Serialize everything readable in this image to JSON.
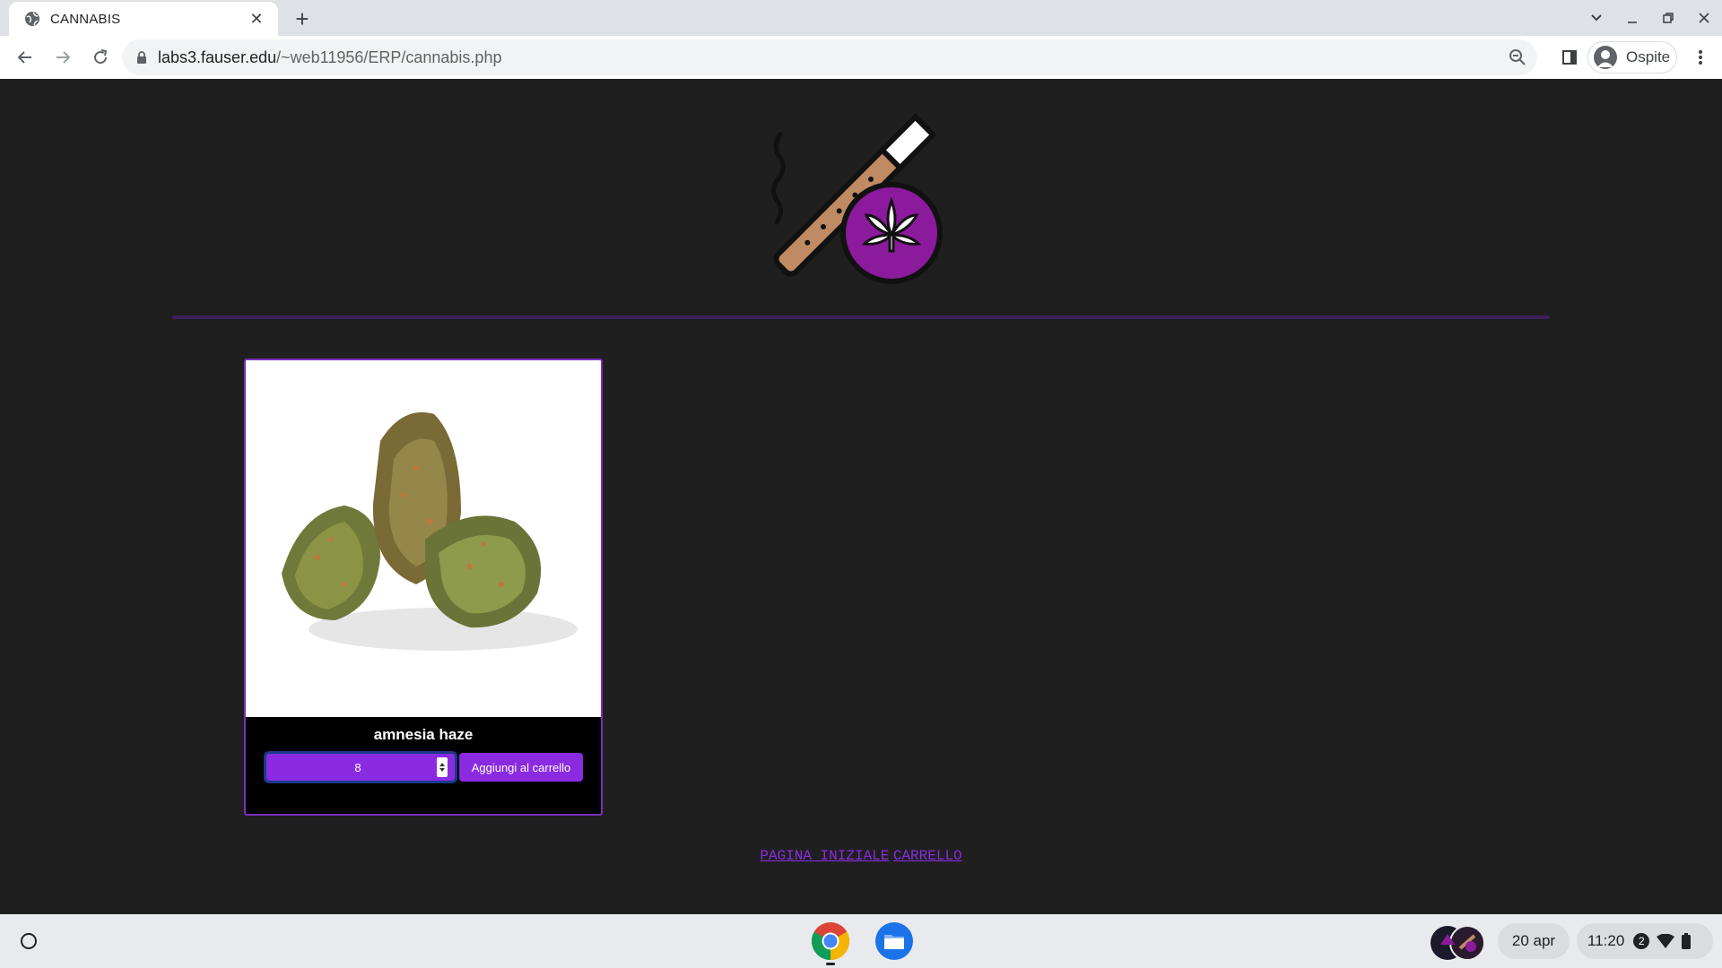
{
  "browser": {
    "tab": {
      "title": "CANNABIS",
      "close_symbol": "✕"
    },
    "new_tab_symbol": "+",
    "url": {
      "host": "labs3.fauser.edu",
      "path": "/~web11956/ERP/cannabis.php"
    },
    "profile_name": "Ospite"
  },
  "page": {
    "product": {
      "name": "amnesia haze",
      "quantity": "8",
      "add_to_cart_label": "Aggiungi al carrello"
    },
    "footer": {
      "home_link": "PAGINA INIZIALE",
      "cart_link": "CARRELLO"
    }
  },
  "shelf": {
    "date": "20 apr",
    "time": "11:20",
    "notification_count": "2"
  },
  "colors": {
    "accent_purple": "#8a2be2",
    "page_background": "#1f1f1f",
    "divider": "#3d1f5e"
  }
}
